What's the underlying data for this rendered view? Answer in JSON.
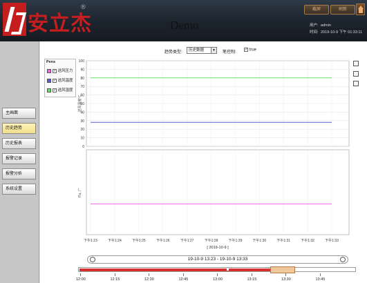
{
  "header": {
    "logo_text": "安立杰",
    "logo_reg": "®",
    "title": "Demo",
    "btn_screen": "截屏",
    "btn_refresh": "刷新",
    "user_label": "用户:",
    "user_value": "admin",
    "time_label": "时间:",
    "time_value": "2019-10-9 下午 01:33:11"
  },
  "sidebar": {
    "items": [
      {
        "label": "主画面"
      },
      {
        "label": "历史趋势"
      },
      {
        "label": "历史报表"
      },
      {
        "label": "报警记录"
      },
      {
        "label": "报警分析"
      },
      {
        "label": "系统设置"
      }
    ]
  },
  "controls": {
    "trend_type_label": "趋势类型:",
    "trend_type_value": "历史数据",
    "pen_control_label": "笔控制:",
    "pen_control_value": "true"
  },
  "pens": {
    "title": "Pens",
    "items": [
      {
        "label": "送风压力",
        "color": "#ee66ee"
      },
      {
        "label": "送风温度",
        "color": "#5b5bd6"
      },
      {
        "label": "送风湿度",
        "color": "#66dd66"
      }
    ]
  },
  "chart_data": {
    "type": "line",
    "upper_panel": {
      "ylim": [
        0,
        100
      ],
      "yticks": [
        0,
        10,
        20,
        30,
        40,
        50,
        60,
        70,
        80,
        90,
        100
      ],
      "ylabel": "送风温度℃",
      "series": [
        {
          "name": "送风湿度",
          "color": "#66dd66",
          "values": [
            80,
            80,
            80,
            80,
            80,
            80,
            80,
            80,
            80,
            80,
            80,
            80
          ]
        },
        {
          "name": "送风温度",
          "color": "#5b5bd6",
          "values": [
            28,
            28,
            28,
            28,
            28,
            28,
            28,
            28,
            28,
            28,
            28,
            28
          ]
        }
      ]
    },
    "lower_panel": {
      "ylabel": "Pa, 厂",
      "series": [
        {
          "name": "送风压力",
          "color": "#ee66ee",
          "values": [
            0,
            0,
            0,
            0,
            0,
            0,
            0,
            0,
            0,
            0,
            0,
            0
          ]
        }
      ]
    },
    "x_ticks": [
      "下午1:23",
      "下午1:24",
      "下午1:25",
      "下午1:26",
      "下午1:27",
      "下午1:28",
      "下午1:29",
      "下午1:30",
      "下午1:31",
      "下午1:32",
      "下午1:33"
    ],
    "xlabel": "[ 2019-10-9 ]"
  },
  "range": {
    "text": "19-10-9 13:23 - 19-10-9 13:33"
  },
  "timeline": {
    "labels": [
      "12:00",
      "12:15",
      "12:30",
      "12:45",
      "13:00",
      "13:15",
      "13:30",
      "13:45"
    ]
  },
  "icons": {
    "expand": "expand-icon",
    "print": "print-icon",
    "save": "save-icon",
    "magnifier": "magnifier-icon",
    "home": "home-icon"
  }
}
